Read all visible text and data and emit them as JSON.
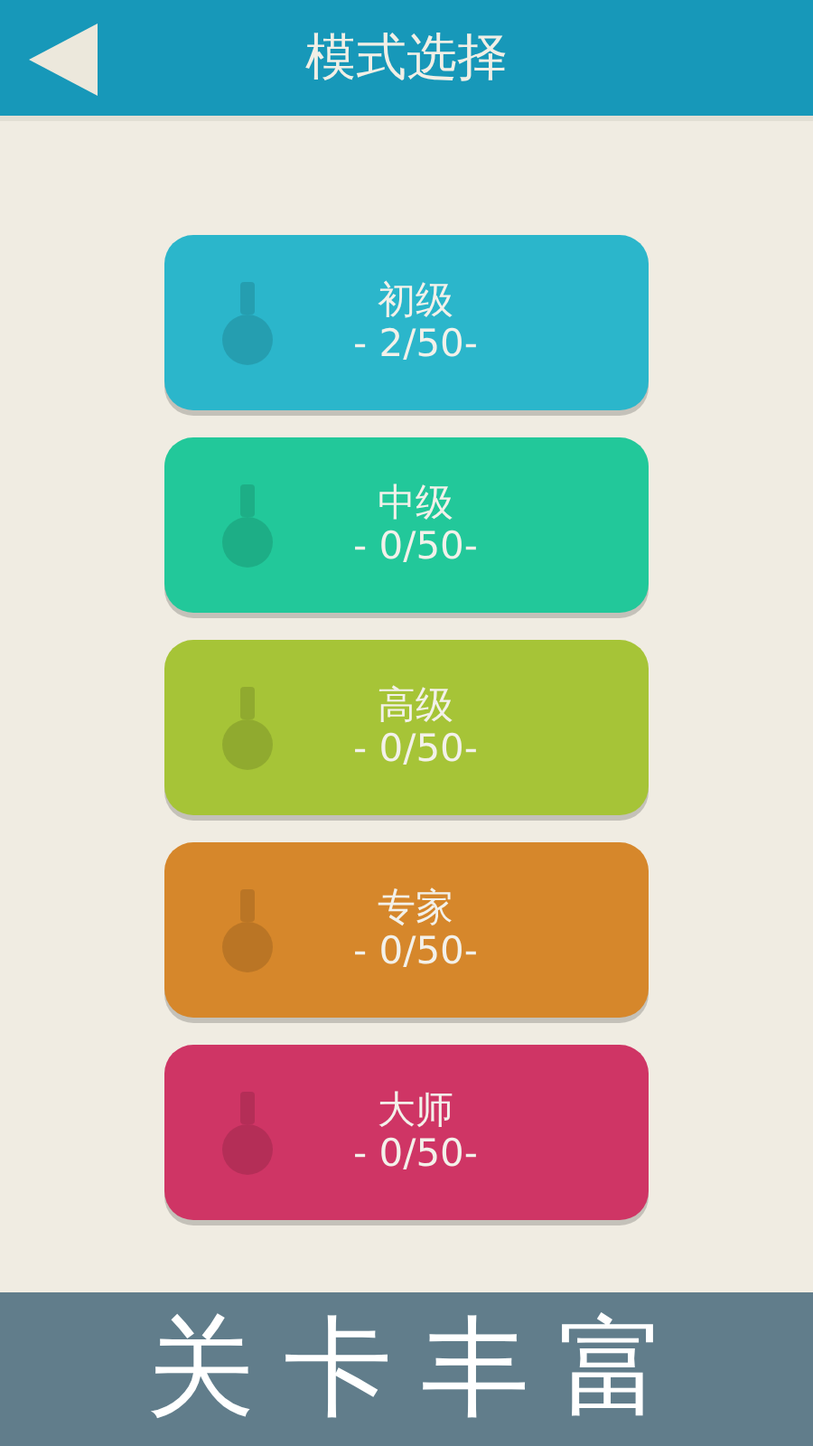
{
  "header": {
    "title": "模式选择"
  },
  "modes": [
    {
      "name": "初级",
      "progress": "- 2/50-",
      "color": "#2bb6cb"
    },
    {
      "name": "中级",
      "progress": "- 0/50-",
      "color": "#22c89a"
    },
    {
      "name": "高级",
      "progress": "- 0/50-",
      "color": "#a6c437"
    },
    {
      "name": "专家",
      "progress": "- 0/50-",
      "color": "#d6872b"
    },
    {
      "name": "大师",
      "progress": "- 0/50-",
      "color": "#cf3565"
    }
  ],
  "banner": {
    "text": "关卡丰富"
  }
}
